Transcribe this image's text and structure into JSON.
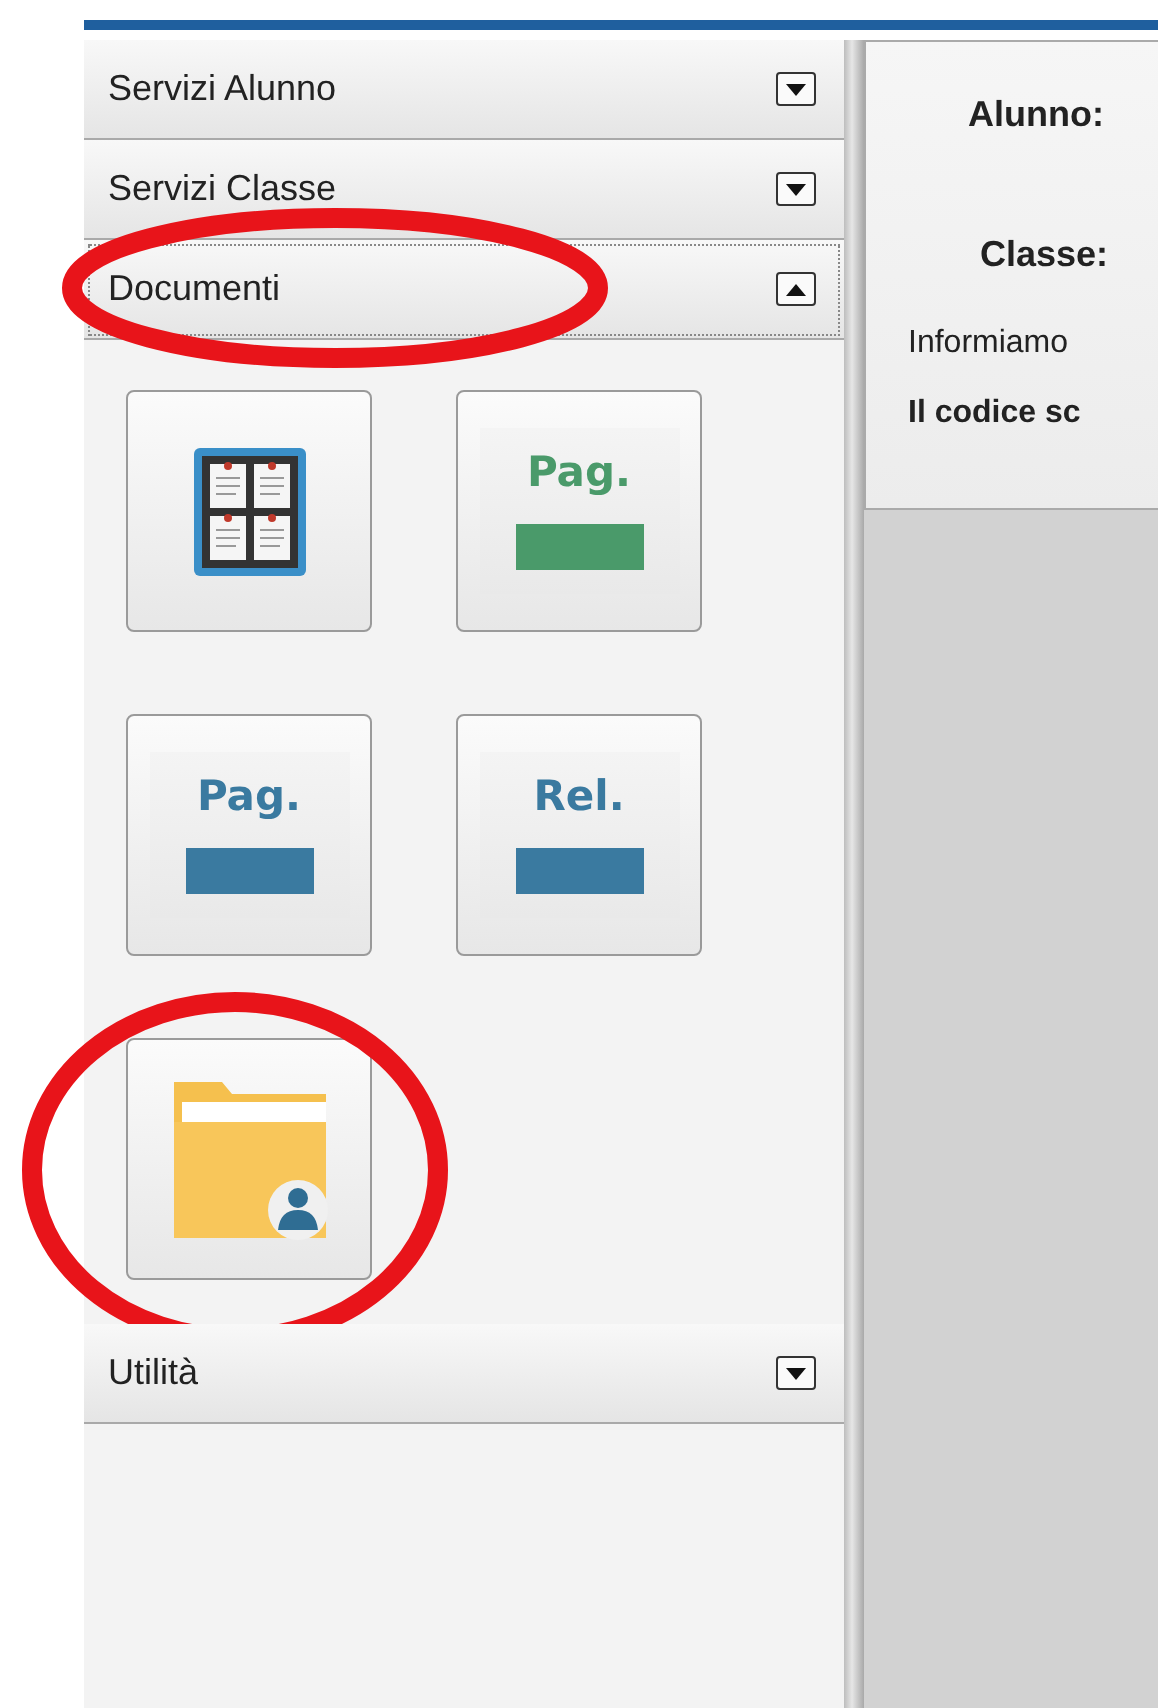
{
  "sidebar": {
    "sections": [
      {
        "title": "Servizi Alunno",
        "expanded": false,
        "circled": false
      },
      {
        "title": "Servizi Classe",
        "expanded": false,
        "circled": false
      },
      {
        "title": "Documenti",
        "expanded": true,
        "circled": true,
        "tiles": [
          {
            "kind": "board",
            "circled": false
          },
          {
            "kind": "label",
            "text": "Pag.",
            "color": "#4a9a6a",
            "circled": false
          },
          {
            "kind": "label",
            "text": "Pag.",
            "color": "#3a7aa0",
            "circled": false
          },
          {
            "kind": "label",
            "text": "Rel.",
            "color": "#3a7aa0",
            "circled": false
          },
          {
            "kind": "folder",
            "circled": true
          }
        ]
      },
      {
        "title": "Utilità",
        "expanded": false,
        "circled": false
      }
    ]
  },
  "content": {
    "fields": [
      {
        "label": "Alunno:"
      },
      {
        "label": "Classe:"
      }
    ],
    "lines": [
      {
        "text": "Informiamo",
        "bold": false
      },
      {
        "text": "Il codice sc",
        "bold": true
      }
    ]
  }
}
